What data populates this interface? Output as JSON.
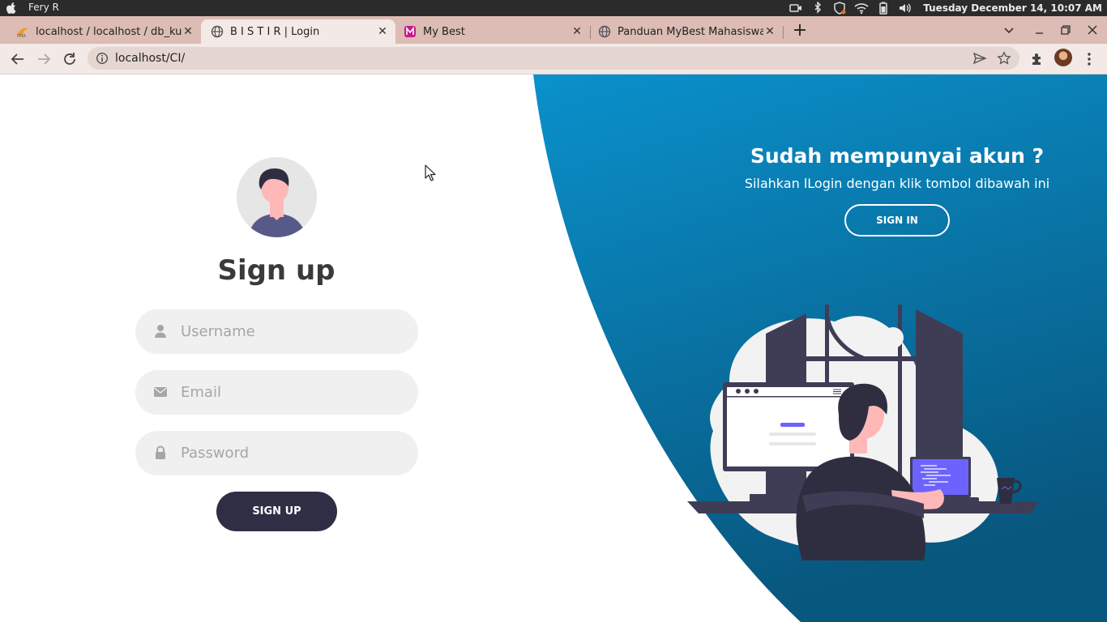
{
  "os": {
    "user": "Fery R",
    "clock": "Tuesday December 14, 10:07 AM"
  },
  "browser": {
    "tabs": [
      {
        "label": "localhost / localhost / db_kur",
        "icon": "phpmyadmin-icon"
      },
      {
        "label": "B I S T I R | Login",
        "icon": "globe-icon",
        "active": true
      },
      {
        "label": "My Best",
        "icon": "mybest-icon"
      },
      {
        "label": "Panduan MyBest Mahasiswa.p",
        "icon": "globe-icon"
      }
    ],
    "url": "localhost/CI/"
  },
  "signup": {
    "title": "Sign up",
    "username_placeholder": "Username",
    "email_placeholder": "Email",
    "password_placeholder": "Password",
    "button": "SIGN UP"
  },
  "panel": {
    "heading": "Sudah mempunyai akun ?",
    "subtext": "Silahkan lLogin dengan klik tombol dibawah ini",
    "button": "SIGN IN"
  },
  "colors": {
    "panel_gradient_start": "#0a91cc",
    "panel_gradient_end": "#08577f",
    "button_dark": "#2e2e45",
    "field_bg": "#f0f0f0",
    "tabstrip_bg": "#dcbcb4"
  }
}
